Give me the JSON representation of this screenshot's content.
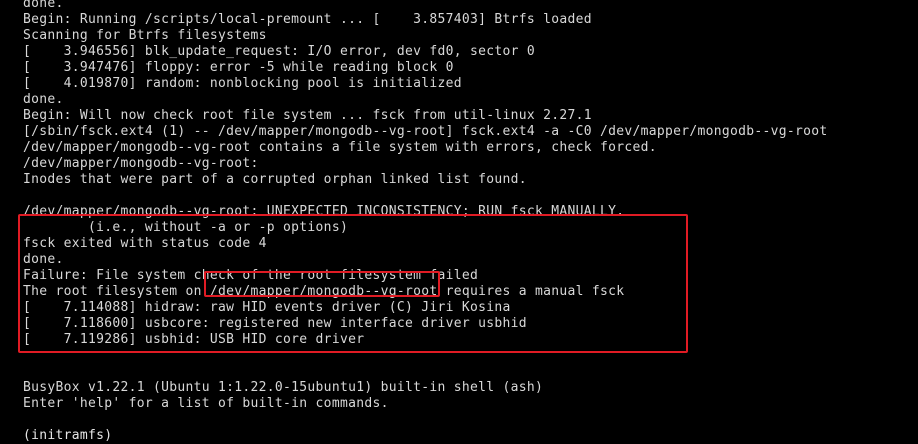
{
  "terminal": {
    "lines": [
      "done.",
      "Begin: Running /scripts/local-premount ... [    3.857403] Btrfs loaded",
      "Scanning for Btrfs filesystems",
      "[    3.946556] blk_update_request: I/O error, dev fd0, sector 0",
      "[    3.947476] floppy: error -5 while reading block 0",
      "[    4.019870] random: nonblocking pool is initialized",
      "done.",
      "Begin: Will now check root file system ... fsck from util-linux 2.27.1",
      "[/sbin/fsck.ext4 (1) -- /dev/mapper/mongodb--vg-root] fsck.ext4 -a -C0 /dev/mapper/mongodb--vg-root",
      "/dev/mapper/mongodb--vg-root contains a file system with errors, check forced.",
      "/dev/mapper/mongodb--vg-root:",
      "Inodes that were part of a corrupted orphan linked list found.",
      "",
      "/dev/mapper/mongodb--vg-root: UNEXPECTED INCONSISTENCY; RUN fsck MANUALLY.",
      "        (i.e., without -a or -p options)",
      "fsck exited with status code 4",
      "done.",
      "Failure: File system check of the root filesystem failed",
      "The root filesystem on /dev/mapper/mongodb--vg-root requires a manual fsck",
      "[    7.114088] hidraw: raw HID events driver (C) Jiri Kosina",
      "[    7.118600] usbcore: registered new interface driver usbhid",
      "[    7.119286] usbhid: USB HID core driver",
      "",
      "",
      "BusyBox v1.22.1 (Ubuntu 1:1.22.0-15ubuntu1) built-in shell (ash)",
      "Enter 'help' for a list of built-in commands.",
      "",
      "(initramfs)"
    ]
  },
  "colors": {
    "background": "#000000",
    "text": "#d8d8d8",
    "annotation": "#e01b24"
  }
}
